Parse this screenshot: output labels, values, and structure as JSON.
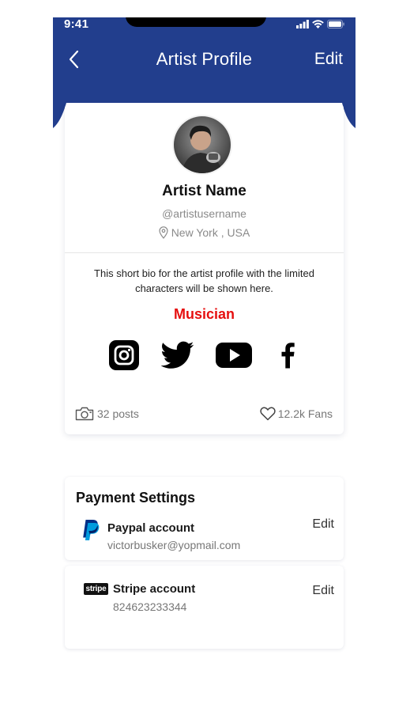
{
  "status_bar": {
    "time": "9:41"
  },
  "header": {
    "title": "Artist Profile",
    "edit_label": "Edit",
    "background_color": "#223e8d"
  },
  "profile": {
    "name": "Artist Name",
    "username": "@artistusername",
    "location": "New York , USA",
    "bio": "This short bio for the artist profile with the limited characters will be shown here.",
    "role": "Musician",
    "role_color": "#e60f0f",
    "socials": [
      "instagram-icon",
      "twitter-icon",
      "youtube-icon",
      "facebook-icon"
    ],
    "posts": "32 posts",
    "fans": "12.2k Fans"
  },
  "payment": {
    "title": "Payment Settings",
    "paypal": {
      "name": "Paypal account",
      "detail": "victorbusker@yopmail.com",
      "edit_label": "Edit"
    },
    "stripe": {
      "logo_text": "stripe",
      "name": "Stripe account",
      "detail": "824623233344",
      "edit_label": "Edit"
    }
  }
}
